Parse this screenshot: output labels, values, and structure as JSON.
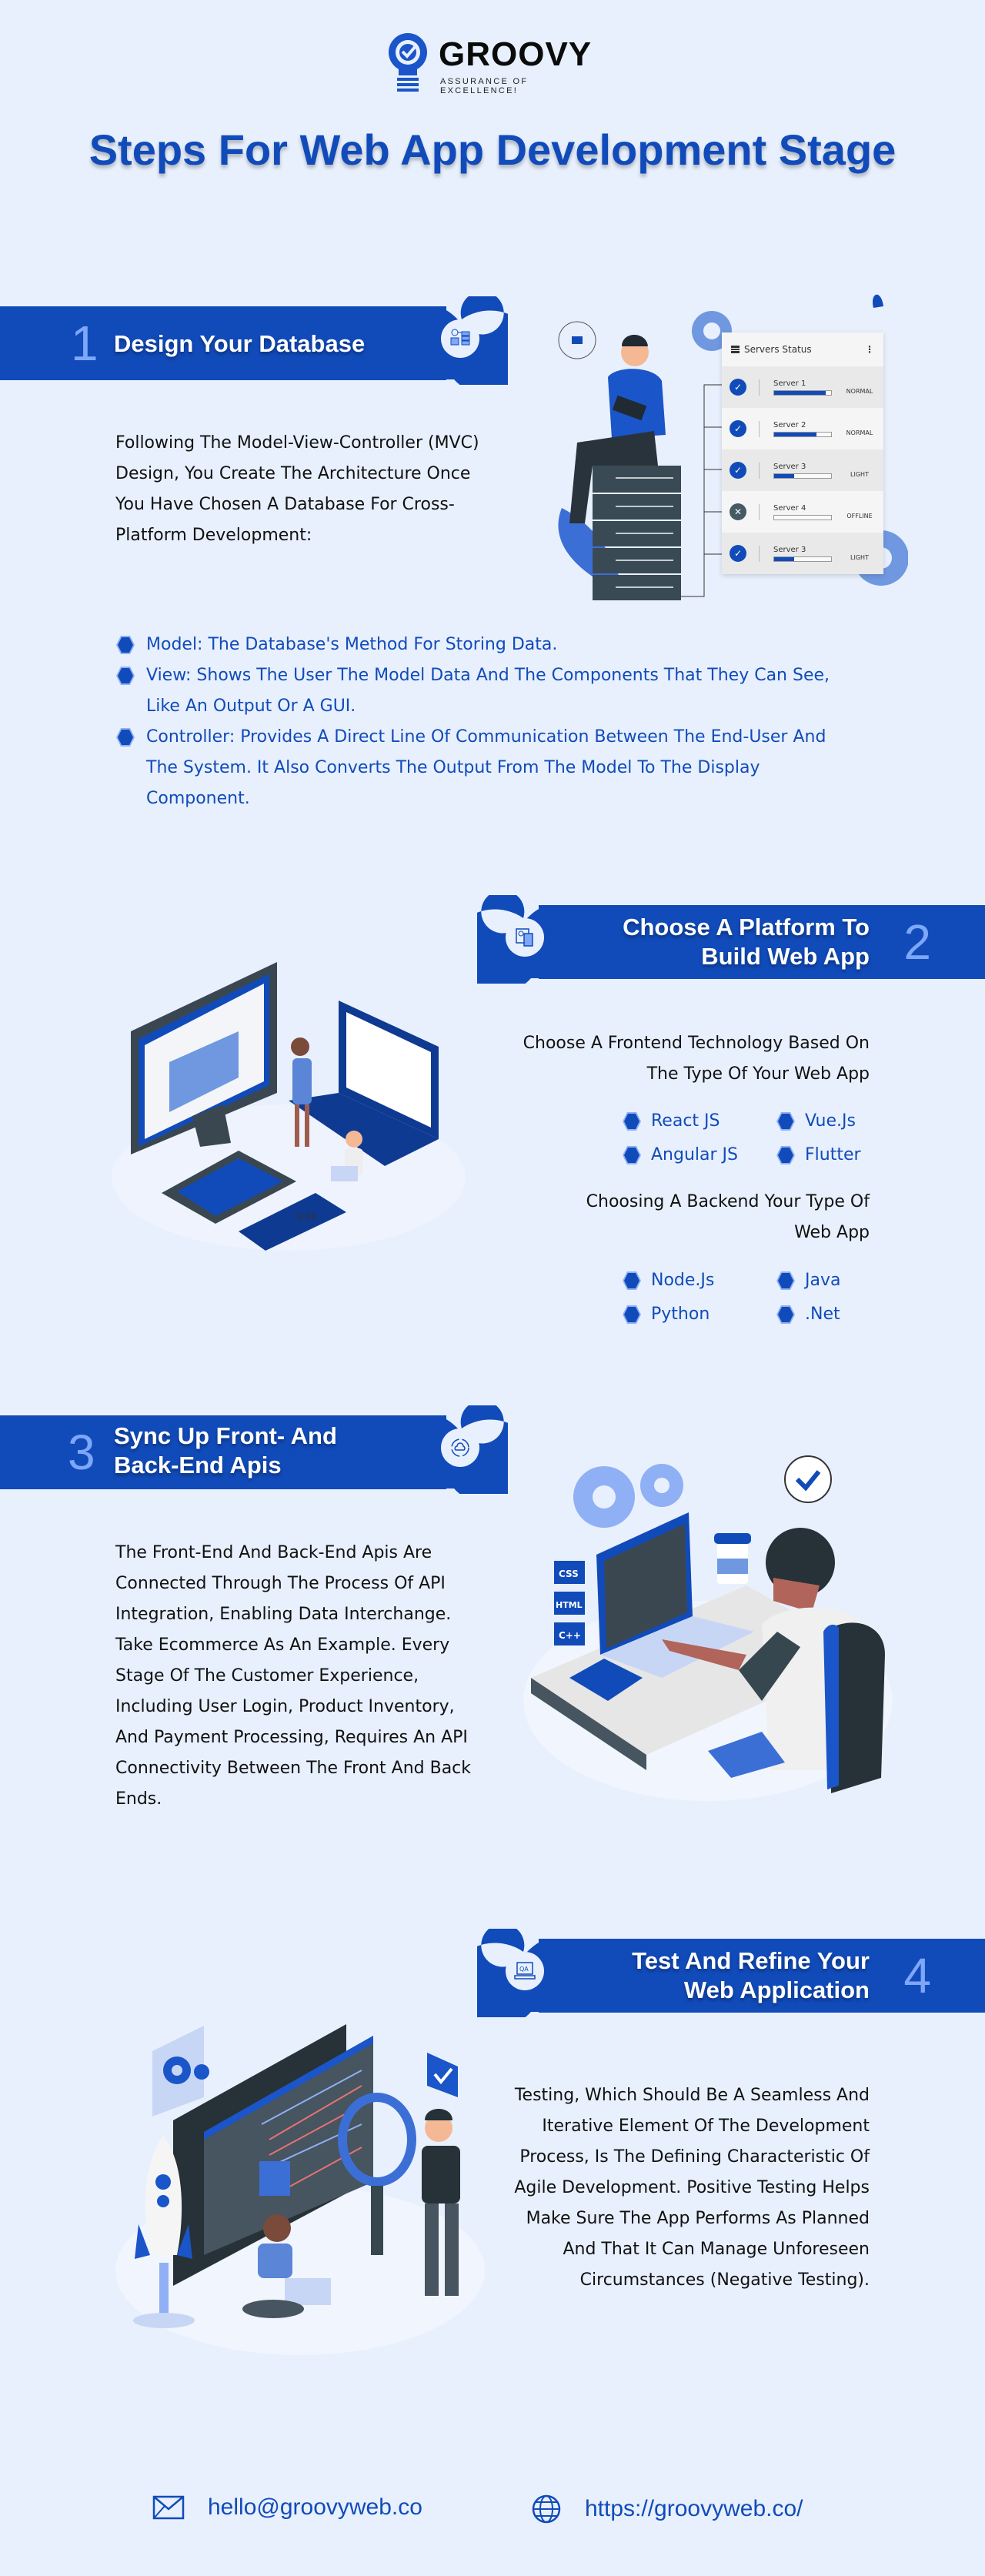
{
  "brand": {
    "name": "GROOVY",
    "tagline": "ASSURANCE OF EXCELLENCE!"
  },
  "page_title": "Steps For Web App Development Stage",
  "colors": {
    "background": "#e8f0fd",
    "primary": "#114bba",
    "accent_number": "#7ea6f9",
    "text": "#111111"
  },
  "steps": [
    {
      "number": "1",
      "title": "Design Your Database",
      "icon": "database-network-icon",
      "paragraph": "Following The Model-View-Controller (MVC) Design, You Create The Architecture Once You Have Chosen A Database For Cross-Platform Development:",
      "bullets": [
        "Model: The Database's Method For Storing Data.",
        "View: Shows The User The Model Data And The Components That They Can See, Like An Output Or A GUI.",
        "Controller: Provides A Direct Line Of Communication Between The End-User And The System. It Also Converts The Output From The Model To The Display Component."
      ],
      "illustration": {
        "panel_title": "Servers Status",
        "servers": [
          {
            "name": "Server 1",
            "load": 0.9,
            "status": "NORMAL",
            "online": true
          },
          {
            "name": "Server 2",
            "load": 0.74,
            "status": "NORMAL",
            "online": true
          },
          {
            "name": "Server 3",
            "load": 0.35,
            "status": "LIGHT",
            "online": true
          },
          {
            "name": "Server 4",
            "load": 0.0,
            "status": "OFFLINE",
            "online": false
          },
          {
            "name": "Server 3",
            "load": 0.35,
            "status": "LIGHT",
            "online": true
          }
        ]
      }
    },
    {
      "number": "2",
      "title_line1": "Choose A Platform To",
      "title_line2": "Build Web App",
      "icon": "devices-settings-icon",
      "frontend_heading": "Choose A Frontend Technology Based On The Type Of Your Web App",
      "frontend": [
        "React JS",
        "Vue.Js",
        "Angular JS",
        "Flutter"
      ],
      "backend_heading": "Choosing A Backend Your Type Of Web App",
      "backend": [
        "Node.Js",
        "Java",
        "Python",
        ".Net"
      ],
      "illustration": {
        "phone_time": "9:00"
      }
    },
    {
      "number": "3",
      "title_line1": "Sync Up Front- And",
      "title_line2": "Back-End Apis",
      "icon": "cloud-sync-icon",
      "paragraph": "The Front-End And Back-End Apis Are Connected Through The Process Of API Integration, Enabling Data Interchange. Take Ecommerce As An Example. Every Stage Of The Customer Experience, Including User Login, Product Inventory, And Payment Processing, Requires An API Connectivity Between The Front And Back Ends.",
      "illustration": {
        "tags": [
          "CSS",
          "HTML",
          "C++"
        ]
      }
    },
    {
      "number": "4",
      "title_line1": "Test And Refine Your",
      "title_line2": "Web Application",
      "icon": "qa-laptop-icon",
      "icon_text": "QA",
      "paragraph": "Testing, Which Should Be A Seamless And Iterative Element Of The Development Process, Is The Defining Characteristic Of Agile Development. Positive Testing Helps Make Sure The App Performs As Planned And That It Can Manage Unforeseen Circumstances (Negative Testing)."
    }
  ],
  "footer": {
    "email": "hello@groovyweb.co",
    "website": "https://groovyweb.co/"
  }
}
